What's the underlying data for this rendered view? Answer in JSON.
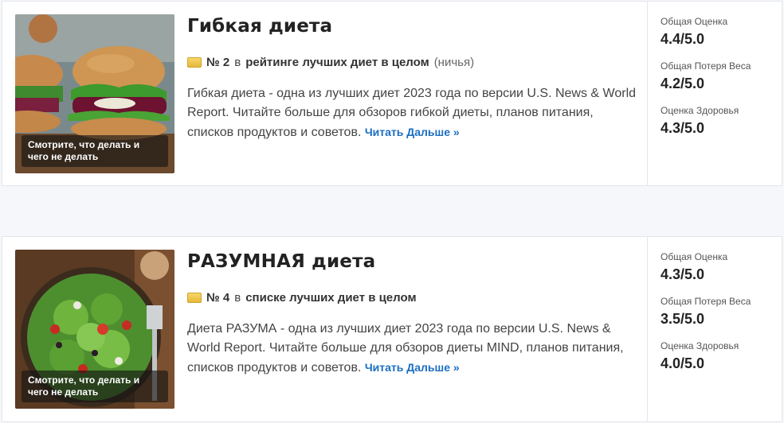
{
  "colors": {
    "link": "#1b6ec2",
    "background": "#f5f7fa",
    "card": "#ffffff"
  },
  "cards": [
    {
      "title": "Гибкая диета",
      "rank_prefix": "№ 2",
      "rank_in": "в",
      "rank_text": "рейтинге лучших диет в целом",
      "rank_note": "(ничья)",
      "description": "Гибкая диета - одна из лучших диет 2023 года по версии U.S. News & World Report. Читайте больше для обзоров гибкой диеты, планов питания, списков продуктов и советов.",
      "read_more": "Читать Дальше »",
      "image_caption": "Смотрите, что делать и чего не делать",
      "scores": [
        {
          "label": "Общая Оценка",
          "value": "4.4/5.0"
        },
        {
          "label": "Общая Потеря Веса",
          "value": "4.2/5.0"
        },
        {
          "label": "Оценка Здоровья",
          "value": "4.3/5.0"
        }
      ]
    },
    {
      "title": "РАЗУМНАЯ диета",
      "rank_prefix": "№ 4",
      "rank_in": "в",
      "rank_text": "списке лучших диет в целом",
      "rank_note": "",
      "description": "Диета РАЗУМА - одна из лучших диет 2023 года по версии U.S. News & World Report. Читайте больше для обзоров диеты MIND, планов питания, списков продуктов и советов.",
      "read_more": "Читать Дальше »",
      "image_caption": "Смотрите, что делать и чего не делать",
      "scores": [
        {
          "label": "Общая Оценка",
          "value": "4.3/5.0"
        },
        {
          "label": "Общая Потеря Веса",
          "value": "3.5/5.0"
        },
        {
          "label": "Оценка Здоровья",
          "value": "4.0/5.0"
        }
      ]
    }
  ]
}
